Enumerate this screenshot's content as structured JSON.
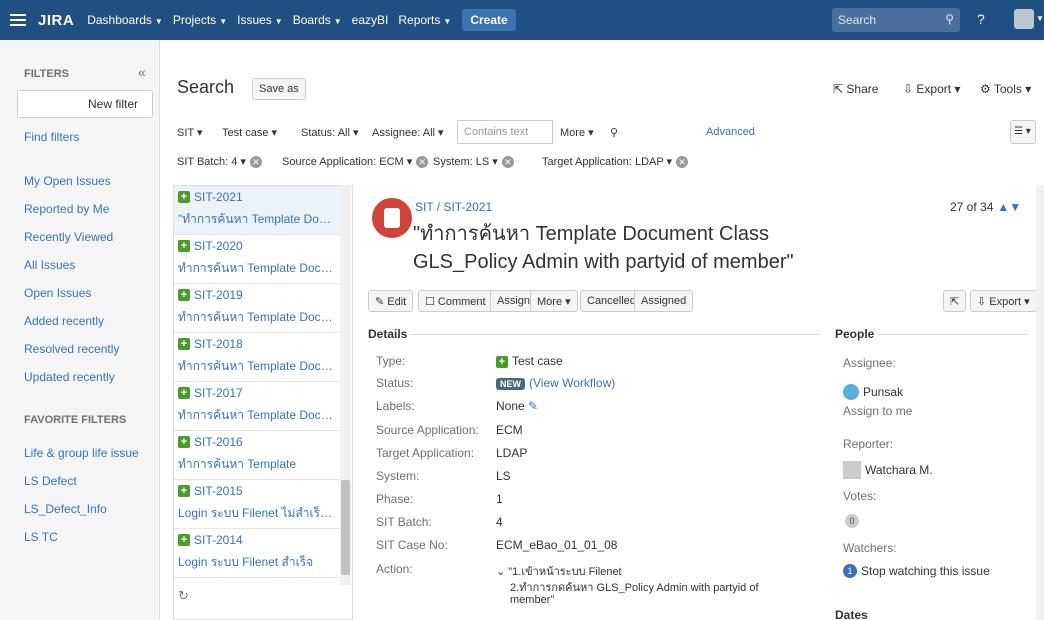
{
  "topnav": {
    "logo": "JIRA",
    "items": [
      "Dashboards",
      "Projects",
      "Issues",
      "Boards",
      "eazyBI",
      "Reports"
    ],
    "create": "Create",
    "search_placeholder": "Search"
  },
  "sidebar": {
    "title": "FILTERS",
    "new_filter": "New filter",
    "find_filters": "Find filters",
    "links": [
      "My Open Issues",
      "Reported by Me",
      "Recently Viewed",
      "All Issues",
      "Open Issues",
      "Added recently",
      "Resolved recently",
      "Updated recently"
    ],
    "favorites_title": "FAVORITE FILTERS",
    "favorites": [
      "Life & group life issue",
      "LS Defect",
      "LS_Defect_Info",
      "LS TC"
    ]
  },
  "header": {
    "title": "Search",
    "save_as": "Save as",
    "share": "Share",
    "export": "Export",
    "tools": "Tools"
  },
  "filters": {
    "sit": "SIT",
    "test_case": "Test case",
    "status": "Status: All",
    "assignee": "Assignee: All",
    "contains": "Contains text",
    "more": "More",
    "advanced": "Advanced",
    "sit_batch": "SIT Batch: 4",
    "source_app": "Source Application: ECM",
    "system": "System: LS",
    "target_app": "Target Application: LDAP"
  },
  "issues": [
    {
      "key": "SIT-2021",
      "summary": "\"ทำการค้นหา Template Docum..."
    },
    {
      "key": "SIT-2020",
      "summary": "ทำการค้นหา Template Docume..."
    },
    {
      "key": "SIT-2019",
      "summary": "ทำการค้นหา Template Docume..."
    },
    {
      "key": "SIT-2018",
      "summary": "ทำการค้นหา Template Docume..."
    },
    {
      "key": "SIT-2017",
      "summary": "ทำการค้นหา Template Docume..."
    },
    {
      "key": "SIT-2016",
      "summary": "ทำการค้นหา Template"
    },
    {
      "key": "SIT-2015",
      "summary": "Login ระบบ Filenet ไม่สำเร็จ Us..."
    },
    {
      "key": "SIT-2014",
      "summary": "Login ระบบ Filenet สำเร็จ"
    }
  ],
  "detail": {
    "crumb": "SIT / SIT-2021",
    "pager": "27 of 34",
    "title": "\"ทำการค้นหา Template Document Class GLS_Policy Admin with partyid of member\"",
    "buttons": {
      "edit": "Edit",
      "comment": "Comment",
      "assign": "Assign",
      "more": "More",
      "cancelled": "Cancelled",
      "assigned": "Assigned",
      "export": "Export"
    },
    "details_head": "Details",
    "fields": [
      {
        "label": "Type:",
        "value": "Test case"
      },
      {
        "label": "Status:",
        "value": "(View Workflow)"
      },
      {
        "label": "Labels:",
        "value": "None"
      },
      {
        "label": "Source Application:",
        "value": "ECM"
      },
      {
        "label": "Target Application:",
        "value": "LDAP"
      },
      {
        "label": "System:",
        "value": "LS"
      },
      {
        "label": "Phase:",
        "value": "1"
      },
      {
        "label": "SIT Batch:",
        "value": "4"
      },
      {
        "label": "SIT Case No:",
        "value": "ECM_eBao_01_01_08"
      },
      {
        "label": "Action:",
        "value": "\"1.เข้าหน้าระบบ Filenet"
      }
    ],
    "status_badge": "NEW",
    "action_line2": "2.ทำการกดค้นหา GLS_Policy Admin with partyid of",
    "action_line3": "member\""
  },
  "people": {
    "head": "People",
    "assignee_label": "Assignee:",
    "assignee": "Punsak",
    "assign_to_me": "Assign to me",
    "reporter_label": "Reporter:",
    "reporter": "Watchara M.",
    "votes_label": "Votes:",
    "votes": "0",
    "watchers_label": "Watchers:",
    "watchers_count": "1",
    "stop_watching": "Stop watching this issue",
    "dates_head": "Dates"
  }
}
